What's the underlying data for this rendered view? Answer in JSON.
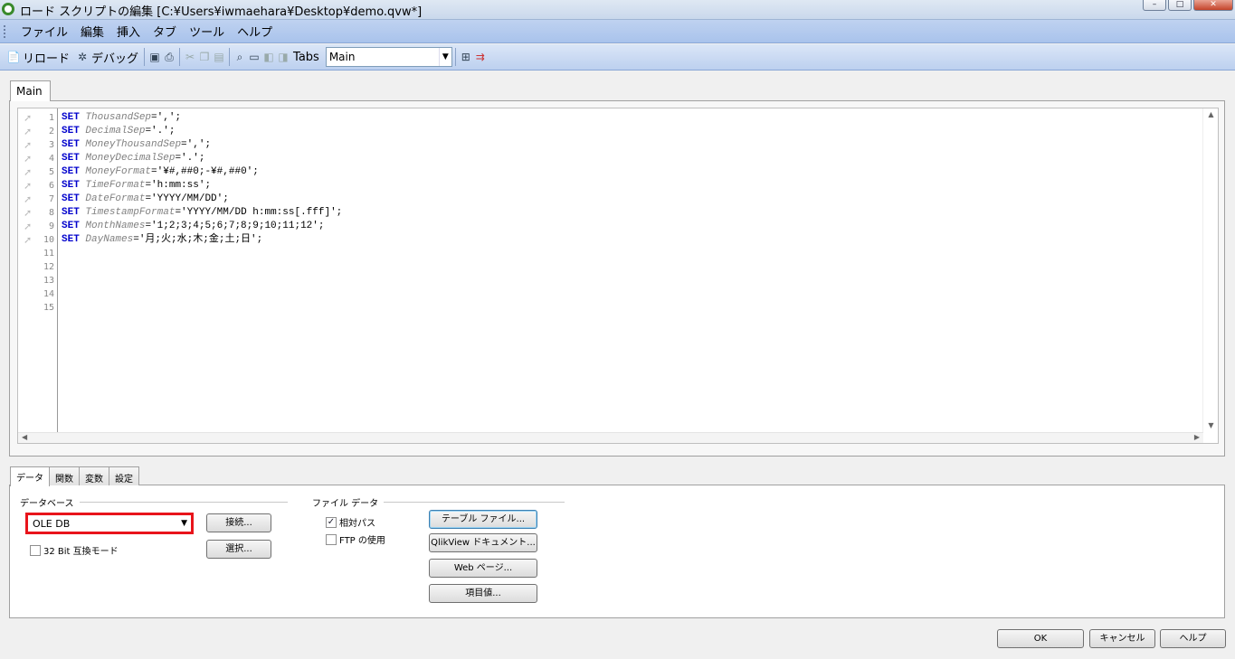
{
  "window": {
    "title": "ロード スクリプトの編集 [C:¥Users¥iwmaehara¥Desktop¥demo.qvw*]",
    "controls": {
      "minimize": "–",
      "maximize": "□",
      "close": "✕"
    }
  },
  "menu": [
    "ファイル",
    "編集",
    "挿入",
    "タブ",
    "ツール",
    "ヘルプ"
  ],
  "toolbar": {
    "reload_label": "リロード",
    "debug_label": "デバッグ",
    "tabs_label": "Tabs",
    "tabs_value": "Main"
  },
  "script_tab": "Main",
  "editor": {
    "line_numbers": [
      "1",
      "2",
      "3",
      "4",
      "5",
      "6",
      "7",
      "8",
      "9",
      "10",
      "11",
      "12",
      "13",
      "14",
      "15"
    ],
    "lines": [
      {
        "kw": "SET",
        "var": "ThousandSep",
        "val": "=',';"
      },
      {
        "kw": "SET",
        "var": "DecimalSep",
        "val": "='.';"
      },
      {
        "kw": "SET",
        "var": "MoneyThousandSep",
        "val": "=',';"
      },
      {
        "kw": "SET",
        "var": "MoneyDecimalSep",
        "val": "='.';"
      },
      {
        "kw": "SET",
        "var": "MoneyFormat",
        "val": "='¥#,##0;-¥#,##0';"
      },
      {
        "kw": "SET",
        "var": "TimeFormat",
        "val": "='h:mm:ss';"
      },
      {
        "kw": "SET",
        "var": "DateFormat",
        "val": "='YYYY/MM/DD';"
      },
      {
        "kw": "SET",
        "var": "TimestampFormat",
        "val": "='YYYY/MM/DD h:mm:ss[.fff]';"
      },
      {
        "kw": "SET",
        "var": "MonthNames",
        "val": "='1;2;3;4;5;6;7;8;9;10;11;12';"
      },
      {
        "kw": "SET",
        "var": "DayNames",
        "val": "='月;火;水;木;金;土;日';"
      }
    ]
  },
  "bottom_tabs": [
    "データ",
    "関数",
    "変数",
    "設定"
  ],
  "data_panel": {
    "database_group": "データベース",
    "database_value": "OLE DB",
    "connect_button": "接続...",
    "select_button": "選択...",
    "bit32_label": "32 Bit 互換モード",
    "file_group": "ファイル データ",
    "relative_path_label": "相対パス",
    "relative_path_checked": true,
    "ftp_label": "FTP の使用",
    "ftp_checked": false,
    "table_file_button": "テーブル ファイル...",
    "qlikview_doc_button": "QlikView ドキュメント...",
    "web_page_button": "Web ページ...",
    "field_value_button": "項目値..."
  },
  "dialog_buttons": {
    "ok": "OK",
    "cancel": "キャンセル",
    "help": "ヘルプ"
  },
  "colors": {
    "keyword": "#0000cc",
    "variable": "#808080",
    "highlight": "#e8141b"
  }
}
